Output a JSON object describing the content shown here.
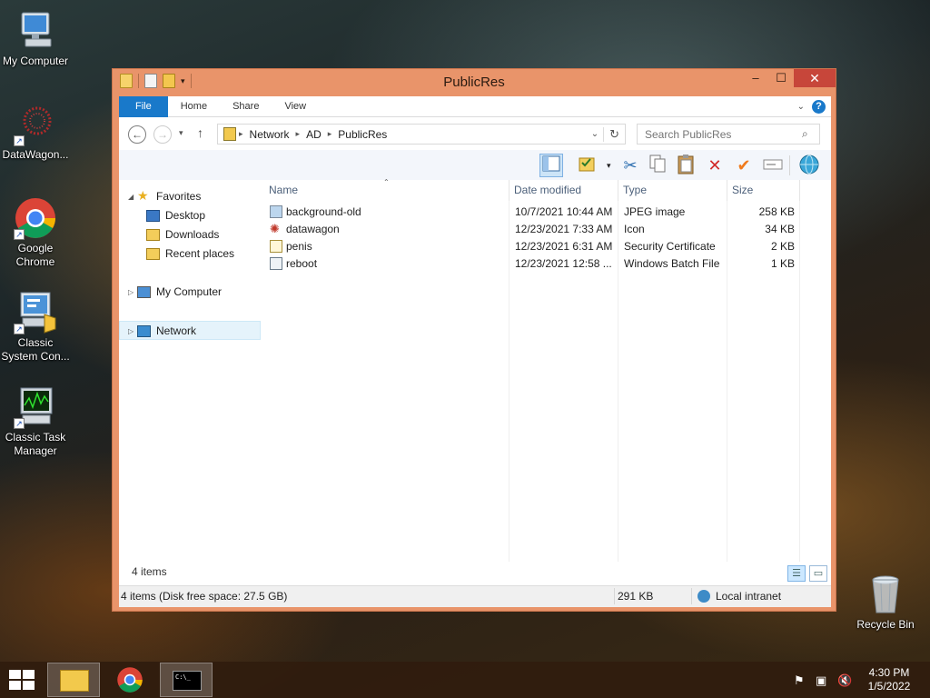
{
  "desktop": {
    "icons": [
      {
        "label": "My Computer",
        "icon": "computer-icon"
      },
      {
        "label": "DataWagon...",
        "icon": "datawagon-icon"
      },
      {
        "label": "Google Chrome",
        "icon": "chrome-icon"
      },
      {
        "label": "Classic System Con...",
        "icon": "control-panel-icon"
      },
      {
        "label": "Classic Task Manager",
        "icon": "task-manager-icon"
      },
      {
        "label": "Recycle Bin",
        "icon": "recycle-bin-icon"
      }
    ]
  },
  "window": {
    "title": "PublicRes",
    "controls": {
      "minimize": "–",
      "maximize": "☐",
      "close": "✕"
    },
    "ribbon_tabs": [
      "File",
      "Home",
      "Share",
      "View"
    ],
    "address": {
      "crumbs": [
        "Network",
        "AD",
        "PublicRes"
      ],
      "search_placeholder": "Search PublicRes"
    },
    "nav_pane": {
      "favorites": "Favorites",
      "favorites_items": [
        "Desktop",
        "Downloads",
        "Recent places"
      ],
      "my_computer": "My Computer",
      "network": "Network"
    },
    "columns": [
      "Name",
      "Date modified",
      "Type",
      "Size"
    ],
    "files": [
      {
        "name": "background-old",
        "date": "10/7/2021 10:44 AM",
        "type": "JPEG image",
        "size": "258 KB",
        "icon": "image-file-icon"
      },
      {
        "name": "datawagon",
        "date": "12/23/2021 7:33 AM",
        "type": "Icon",
        "size": "34 KB",
        "icon": "ico-file-icon"
      },
      {
        "name": "penis",
        "date": "12/23/2021 6:31 AM",
        "type": "Security Certificate",
        "size": "2 KB",
        "icon": "certificate-file-icon"
      },
      {
        "name": "reboot",
        "date": "12/23/2021 12:58 ...",
        "type": "Windows Batch File",
        "size": "1 KB",
        "icon": "batch-file-icon"
      }
    ],
    "item_count": "4 items",
    "status": {
      "left": "4 items (Disk free space: 27.5 GB)",
      "size": "291 KB",
      "zone": "Local intranet"
    }
  },
  "taskbar": {
    "clock_time": "4:30 PM",
    "clock_date": "1/5/2022"
  },
  "colors": {
    "window_frame": "#e9946a",
    "accent": "#1979ca",
    "close_button": "#c7463a"
  }
}
